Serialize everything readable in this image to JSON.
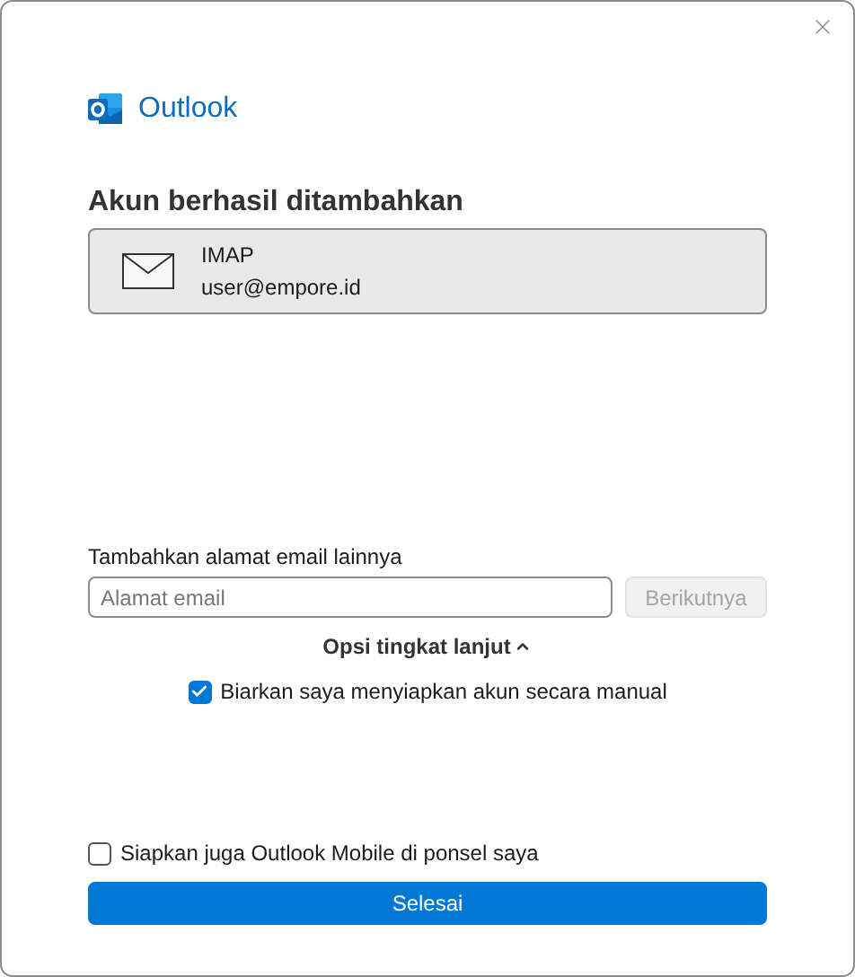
{
  "app": {
    "name": "Outlook"
  },
  "heading": "Akun berhasil ditambahkan",
  "account": {
    "type": "IMAP",
    "email": "user@empore.id"
  },
  "add_email": {
    "label": "Tambahkan alamat email lainnya",
    "placeholder": "Alamat email",
    "button": {
      "label": "Berikutnya",
      "disabled": true
    }
  },
  "advanced": {
    "label": "Opsi tingkat lanjut",
    "expanded": true,
    "options": [
      {
        "label": "Biarkan saya menyiapkan akun secara manual",
        "checked": true
      }
    ]
  },
  "mobile": {
    "label": "Siapkan juga Outlook Mobile di ponsel saya",
    "checked": false
  },
  "finish_button": "Selesai"
}
